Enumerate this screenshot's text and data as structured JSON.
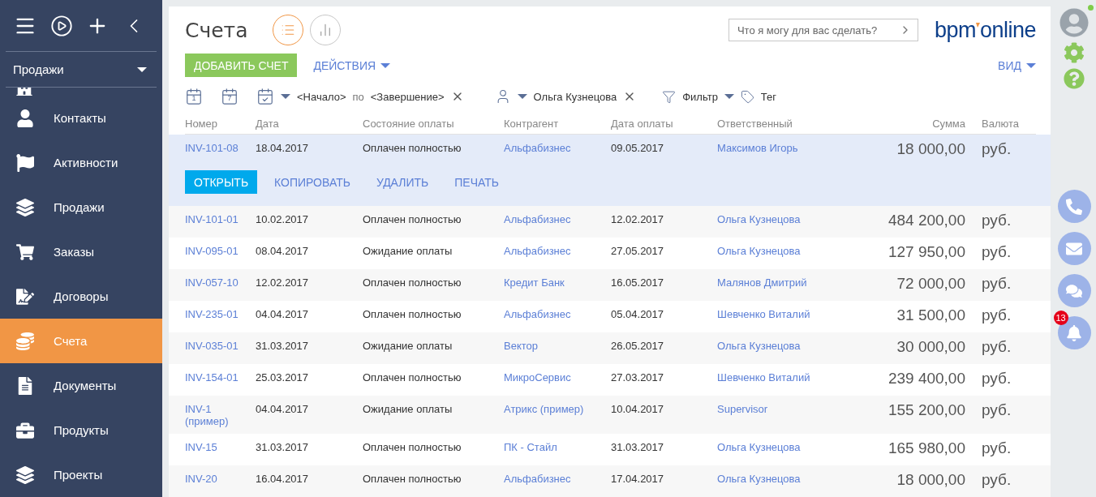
{
  "sidebar": {
    "section": {
      "label": "Продажи"
    },
    "items": [
      {
        "label": "Контакты",
        "selected": false
      },
      {
        "label": "Активности",
        "selected": false
      },
      {
        "label": "Продажи",
        "selected": false
      },
      {
        "label": "Заказы",
        "selected": false
      },
      {
        "label": "Договоры",
        "selected": false
      },
      {
        "label": "Счета",
        "selected": true
      },
      {
        "label": "Документы",
        "selected": false
      },
      {
        "label": "Продукты",
        "selected": false
      },
      {
        "label": "Проекты",
        "selected": false
      }
    ]
  },
  "header": {
    "title": "Счета",
    "view_toggles": [
      {
        "kind": "list",
        "selected": true
      },
      {
        "kind": "chart",
        "selected": false
      }
    ],
    "command": {
      "placeholder": "Что я могу для вас сделать?"
    },
    "logo": {
      "left": "bpm",
      "right": "online"
    }
  },
  "actions": {
    "add_button": "ДОБАВИТЬ СЧЕТ",
    "actions_menu": "ДЕЙСТВИЯ",
    "view_menu": "ВИД"
  },
  "filters": {
    "period_buttons": [
      {
        "label": "1"
      },
      {
        "label": "7"
      }
    ],
    "start": "<Начало>",
    "by": "по",
    "end": "<Завершение>",
    "owner": "Ольга Кузнецова",
    "filter": "Фильтр",
    "tag": "Тег"
  },
  "table": {
    "columns": [
      "Номер",
      "Дата",
      "Состояние оплаты",
      "Контрагент",
      "Дата оплаты",
      "Ответственный",
      "Сумма",
      "Валюта"
    ],
    "row_actions": [
      "ОТКРЫТЬ",
      "КОПИРОВАТЬ",
      "УДАЛИТЬ",
      "ПЕЧАТЬ"
    ],
    "rows": [
      {
        "number": "INV-101-08",
        "date": "18.04.2017",
        "status": "Оплачен полностью",
        "account": "Альфабизнес",
        "paid": "09.05.2017",
        "owner": "Максимов Игорь",
        "amount": "18 000,00",
        "currency": "руб.",
        "selected": true
      },
      {
        "number": "INV-101-01",
        "date": "10.02.2017",
        "status": "Оплачен полностью",
        "account": "Альфабизнес",
        "paid": "12.02.2017",
        "owner": "Ольга Кузнецова",
        "amount": "484 200,00",
        "currency": "руб.",
        "selected": false
      },
      {
        "number": "INV-095-01",
        "date": "08.04.2017",
        "status": "Ожидание оплаты",
        "account": "Альфабизнес",
        "paid": "27.05.2017",
        "owner": "Ольга Кузнецова",
        "amount": "127 950,00",
        "currency": "руб.",
        "selected": false
      },
      {
        "number": "INV-057-10",
        "date": "12.02.2017",
        "status": "Оплачен полностью",
        "account": "Кредит Банк",
        "paid": "16.05.2017",
        "owner": "Малянов Дмитрий",
        "amount": "72 000,00",
        "currency": "руб.",
        "selected": false
      },
      {
        "number": "INV-235-01",
        "date": "04.04.2017",
        "status": "Оплачен полностью",
        "account": "Альфабизнес",
        "paid": "05.04.2017",
        "owner": "Шевченко Виталий",
        "amount": "31 500,00",
        "currency": "руб.",
        "selected": false
      },
      {
        "number": "INV-035-01",
        "date": "31.03.2017",
        "status": "Ожидание оплаты",
        "account": "Вектор",
        "paid": "26.05.2017",
        "owner": "Ольга Кузнецова",
        "amount": "30 000,00",
        "currency": "руб.",
        "selected": false
      },
      {
        "number": "INV-154-01",
        "date": "25.03.2017",
        "status": "Оплачен полностью",
        "account": "МикроСервис",
        "paid": "27.03.2017",
        "owner": "Шевченко Виталий",
        "amount": "239 400,00",
        "currency": "руб.",
        "selected": false
      },
      {
        "number": "INV-1 (пример)",
        "date": "04.04.2017",
        "status": "Ожидание оплаты",
        "account": "Атрикс (пример)",
        "paid": "10.04.2017",
        "owner": "Supervisor",
        "amount": "155 200,00",
        "currency": "руб.",
        "selected": false
      },
      {
        "number": "INV-15",
        "date": "31.03.2017",
        "status": "Оплачен полностью",
        "account": "ПК - Стайл",
        "paid": "31.03.2017",
        "owner": "Ольга Кузнецова",
        "amount": "165 980,00",
        "currency": "руб.",
        "selected": false
      },
      {
        "number": "INV-20",
        "date": "16.04.2017",
        "status": "Оплачен полностью",
        "account": "Альфабизнес",
        "paid": "17.04.2017",
        "owner": "Ольга Кузнецова",
        "amount": "18 000,00",
        "currency": "руб.",
        "selected": false
      }
    ]
  },
  "right_bar": {
    "notifications": {
      "count": "13"
    },
    "buttons": [
      {
        "kind": "phone"
      },
      {
        "kind": "email"
      },
      {
        "kind": "chat"
      },
      {
        "kind": "bell"
      }
    ]
  }
}
